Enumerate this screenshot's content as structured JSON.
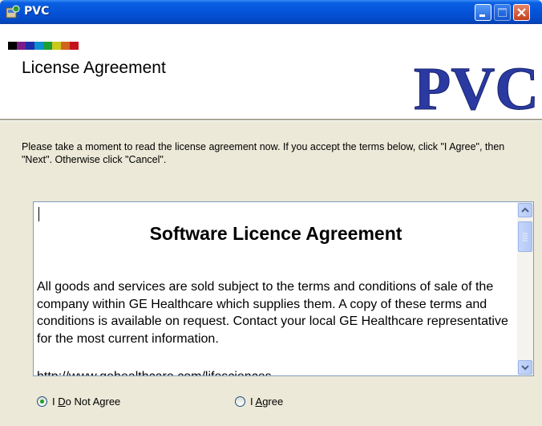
{
  "window": {
    "title": "PVC"
  },
  "header": {
    "title": "License Agreement",
    "logo_text": "PVC",
    "colorbar": [
      "#000000",
      "#7b1c8c",
      "#1c2fa8",
      "#0d8fd0",
      "#1e9e34",
      "#c9c81c",
      "#d0641c",
      "#c4131c"
    ]
  },
  "instructions": "Please take a moment to read the license agreement now. If you accept the terms below, click \"I Agree\", then \"Next\". Otherwise click \"Cancel\".",
  "license": {
    "heading": "Software Licence Agreement",
    "body": "All goods and services are sold subject to the terms and conditions of sale of the company within GE Healthcare which supplies them. A copy of these terms and conditions is available on request. Contact your local GE Healthcare representative for the most current information.",
    "link_partial": "http://www.gehealthcare.com/lifesciences"
  },
  "options": {
    "not_agree": {
      "prefix": "I ",
      "accel": "D",
      "rest": "o Not Agree",
      "checked": true
    },
    "agree": {
      "prefix": "I ",
      "accel": "A",
      "rest": "gree",
      "checked": false
    }
  }
}
